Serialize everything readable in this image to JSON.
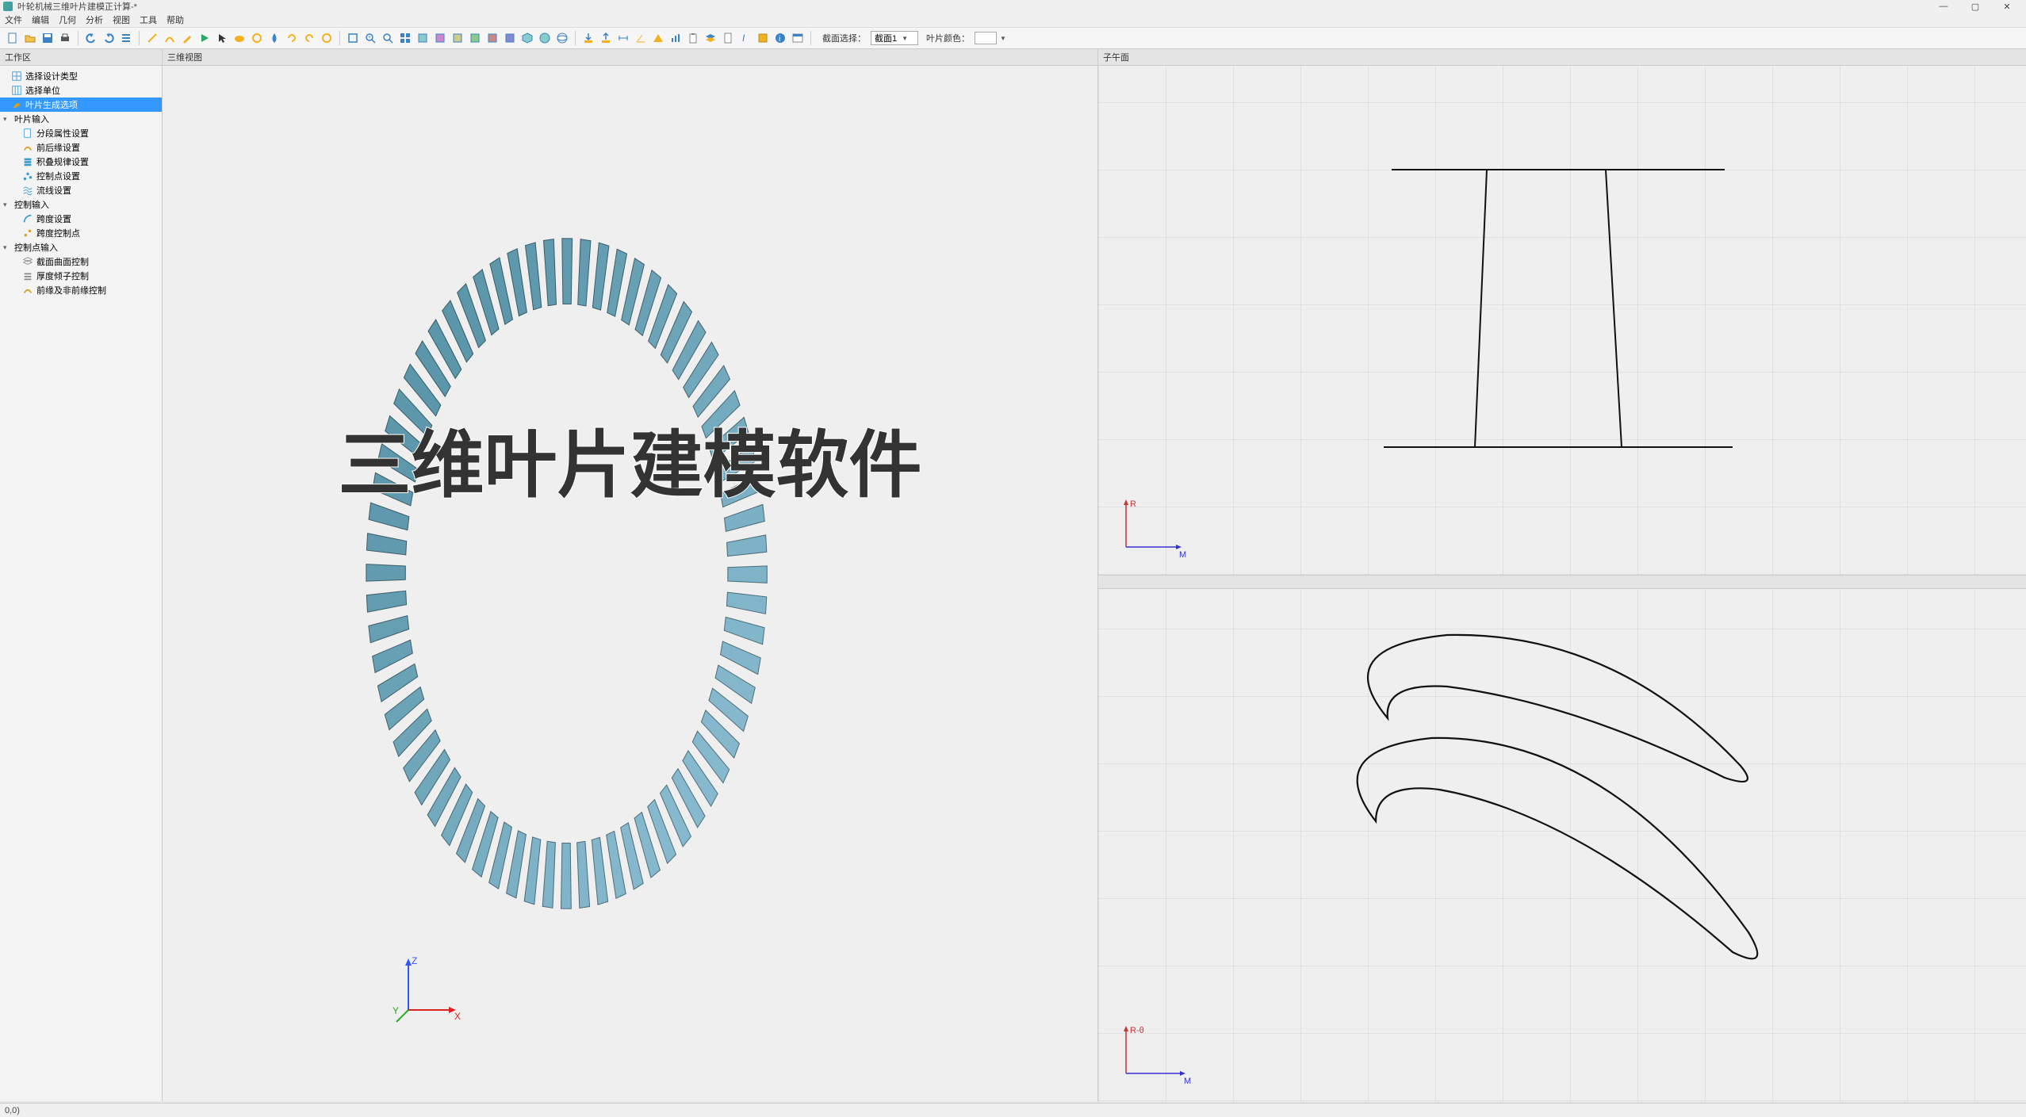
{
  "title_bar": {
    "title": "叶轮机械三维叶片建模正计算-*"
  },
  "menu": {
    "items": [
      "文件",
      "编辑",
      "几何",
      "分析",
      "视图",
      "工具",
      "帮助"
    ]
  },
  "toolbar": {
    "section_select_label": "截面选择：",
    "section_select_value": "截面1",
    "color_label": "叶片颜色："
  },
  "sidebar": {
    "title": "工作区",
    "root_items": [
      {
        "label": "选择设计类型",
        "icon": "grid",
        "color": "#3b9bd6"
      },
      {
        "label": "选择单位",
        "icon": "grid",
        "color": "#3b9bd6"
      },
      {
        "label": "叶片生成选项",
        "icon": "leaf",
        "color": "#d9a020",
        "selected": true
      }
    ],
    "groups": [
      {
        "label": "叶片输入",
        "children": [
          {
            "label": "分段属性设置",
            "icon": "page",
            "color": "#3b9bd6"
          },
          {
            "label": "前后缘设置",
            "icon": "curve",
            "color": "#d9a020"
          },
          {
            "label": "积叠规律设置",
            "icon": "stack",
            "color": "#3b9bd6"
          },
          {
            "label": "控制点设置",
            "icon": "points",
            "color": "#3b9bd6"
          },
          {
            "label": "流线设置",
            "icon": "wave",
            "color": "#3b9bd6"
          }
        ]
      },
      {
        "label": "控制输入",
        "children": [
          {
            "label": "跨度设置",
            "icon": "arc",
            "color": "#3b9bd6"
          },
          {
            "label": "跨度控制点",
            "icon": "ctrlpt",
            "color": "#d9a020"
          }
        ]
      },
      {
        "label": "控制点输入",
        "children": [
          {
            "label": "截面曲面控制",
            "icon": "layers",
            "color": "#888"
          },
          {
            "label": "厚度倾子控制",
            "icon": "stack2",
            "color": "#888"
          },
          {
            "label": "前缘及非前缘控制",
            "icon": "curve2",
            "color": "#d9a020"
          }
        ]
      }
    ]
  },
  "views": {
    "view3d_label": "三维视图",
    "meridian_label": "子午面",
    "axis_top": {
      "r": "R",
      "m": "M"
    },
    "axis_bottom": {
      "r": "R-θ",
      "m": "M"
    }
  },
  "overlay": {
    "text": "三维叶片建模软件"
  },
  "status": {
    "coord": "0,0)"
  },
  "axis3d": {
    "x": "X",
    "y": "Y",
    "z": "Z"
  }
}
